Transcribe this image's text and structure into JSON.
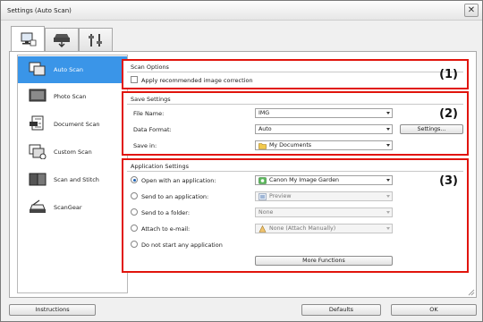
{
  "window": {
    "title": "Settings (Auto Scan)",
    "close_glyph": "✕"
  },
  "tabs": [
    {
      "icon": "scan-from-computer-icon",
      "selected": true
    },
    {
      "icon": "scan-from-operation-panel-icon",
      "selected": false
    },
    {
      "icon": "general-settings-icon",
      "selected": false
    }
  ],
  "sidebar": {
    "items": [
      {
        "label": "Auto Scan",
        "icon": "auto-scan-icon",
        "selected": true
      },
      {
        "label": "Photo Scan",
        "icon": "photo-scan-icon",
        "selected": false
      },
      {
        "label": "Document Scan",
        "icon": "document-scan-icon",
        "selected": false
      },
      {
        "label": "Custom Scan",
        "icon": "custom-scan-icon",
        "selected": false
      },
      {
        "label": "Scan and Stitch",
        "icon": "scan-and-stitch-icon",
        "selected": false
      },
      {
        "label": "ScanGear",
        "icon": "scangear-icon",
        "selected": false
      }
    ]
  },
  "scan_options": {
    "title": "Scan Options",
    "number": "(1)",
    "apply_correction_label": "Apply recommended image correction",
    "apply_correction_checked": false
  },
  "save_settings": {
    "title": "Save Settings",
    "number": "(2)",
    "file_name_label": "File Name:",
    "file_name_value": "IMG",
    "data_format_label": "Data Format:",
    "data_format_value": "Auto",
    "settings_button": "Settings...",
    "save_in_label": "Save in:",
    "save_in_value": "My Documents"
  },
  "application_settings": {
    "title": "Application Settings",
    "number": "(3)",
    "selected_option": "open_with_application",
    "options": {
      "open_with_application": {
        "label": "Open with an application:",
        "value": "Canon My Image Garden",
        "enabled": true
      },
      "send_to_application": {
        "label": "Send to an application:",
        "value": "Preview",
        "enabled": false
      },
      "send_to_folder": {
        "label": "Send to a folder:",
        "value": "None",
        "enabled": false
      },
      "attach_to_email": {
        "label": "Attach to e-mail:",
        "value": "None (Attach Manually)",
        "enabled": false
      },
      "do_not_start": {
        "label": "Do not start any application"
      }
    },
    "more_functions_button": "More Functions"
  },
  "footer": {
    "instructions_button": "Instructions",
    "defaults_button": "Defaults",
    "ok_button": "OK"
  },
  "colors": {
    "highlight_border": "#e1140c",
    "selection": "#3a95e8"
  }
}
